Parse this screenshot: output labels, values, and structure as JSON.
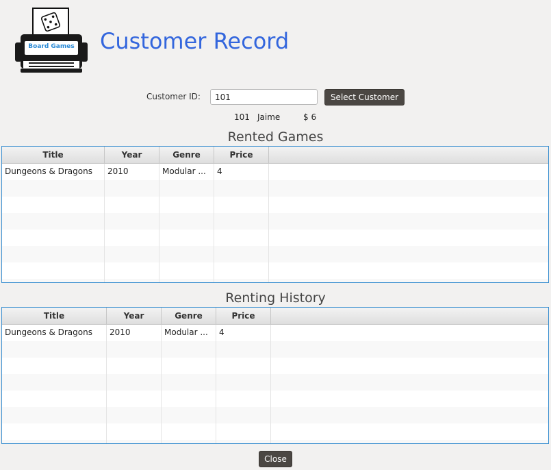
{
  "logo": {
    "text": "Board Games",
    "icon": "dice-printer-icon"
  },
  "header": {
    "title": "Customer Record"
  },
  "customer_select": {
    "label": "Customer ID:",
    "value": "101",
    "button_label": "Select Customer"
  },
  "summary": {
    "id": "101",
    "name": "Jaime",
    "balance": "$ 6"
  },
  "rented": {
    "title": "Rented Games",
    "columns": [
      "Title",
      "Year",
      "Genre",
      "Price"
    ],
    "rows": [
      {
        "title": "Dungeons & Dragons",
        "year": "2010",
        "genre": "Modular ...",
        "price": "4"
      }
    ]
  },
  "history": {
    "title": "Renting History",
    "columns": [
      "Title",
      "Year",
      "Genre",
      "Price"
    ],
    "rows": [
      {
        "title": "Dungeons & Dragons",
        "year": "2010",
        "genre": "Modular ...",
        "price": "4"
      }
    ]
  },
  "footer": {
    "close_label": "Close"
  },
  "colors": {
    "title": "#3366dd",
    "button": "#4b4743",
    "table_border": "#3a8fd0",
    "background": "#f2f1f0"
  }
}
